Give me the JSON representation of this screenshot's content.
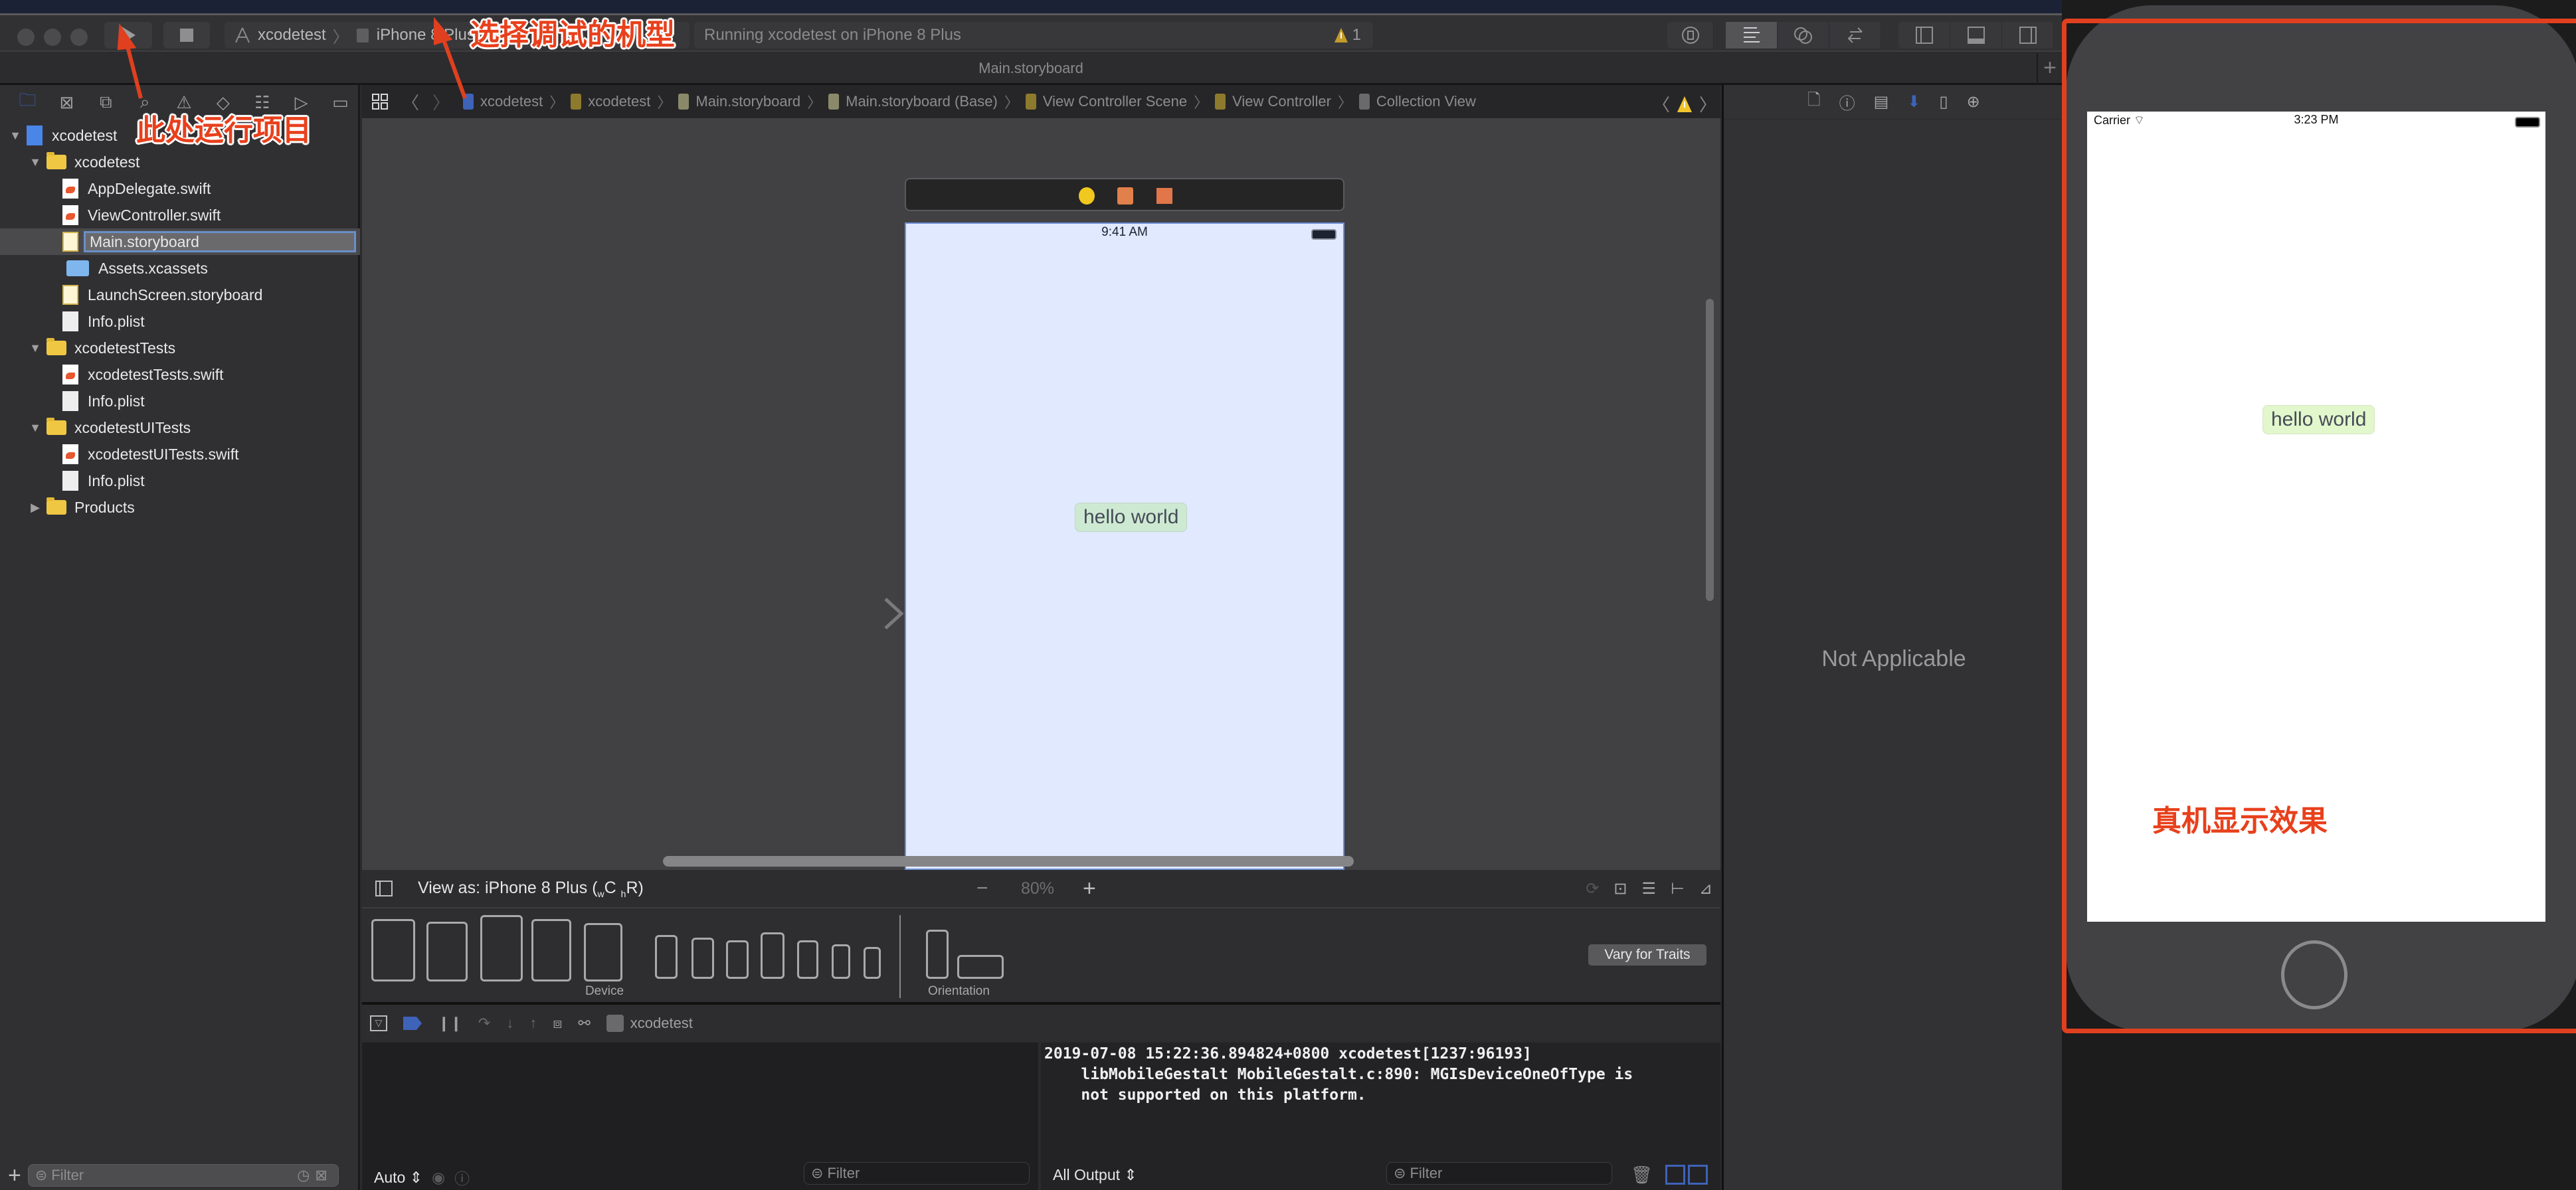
{
  "toolbar": {
    "scheme_target": "xcodetest",
    "scheme_device": "iPhone 8 Plus",
    "activity_text": "Running xcodetest on iPhone 8 Plus",
    "warning_count": "1",
    "run_icon": "play-icon",
    "stop_icon": "stop-icon"
  },
  "tab": {
    "title": "Main.storyboard"
  },
  "annotations": {
    "run_here": "此处运行项目",
    "choose_device": "选择调试的机型",
    "device_result": "真机显示效果"
  },
  "navigator": {
    "tabs": [
      "folder-icon",
      "source-control-icon",
      "symbol-icon",
      "find-icon",
      "issue-icon",
      "test-icon",
      "debug-icon",
      "breakpoint-icon",
      "report-icon"
    ],
    "tree": [
      {
        "label": "xcodetest",
        "kind": "project",
        "depth": 0,
        "expanded": true
      },
      {
        "label": "xcodetest",
        "kind": "folder",
        "depth": 1,
        "expanded": true
      },
      {
        "label": "AppDelegate.swift",
        "kind": "swift",
        "depth": 2
      },
      {
        "label": "ViewController.swift",
        "kind": "swift",
        "depth": 2
      },
      {
        "label": "Main.storyboard",
        "kind": "storyboard",
        "depth": 2,
        "selected": true
      },
      {
        "label": "Assets.xcassets",
        "kind": "assets",
        "depth": 2
      },
      {
        "label": "LaunchScreen.storyboard",
        "kind": "storyboard",
        "depth": 2
      },
      {
        "label": "Info.plist",
        "kind": "plist",
        "depth": 2
      },
      {
        "label": "xcodetestTests",
        "kind": "folder",
        "depth": 1,
        "expanded": true
      },
      {
        "label": "xcodetestTests.swift",
        "kind": "swift",
        "depth": 2
      },
      {
        "label": "Info.plist",
        "kind": "plist",
        "depth": 2
      },
      {
        "label": "xcodetestUITests",
        "kind": "folder",
        "depth": 1,
        "expanded": true
      },
      {
        "label": "xcodetestUITests.swift",
        "kind": "swift",
        "depth": 2
      },
      {
        "label": "Info.plist",
        "kind": "plist",
        "depth": 2
      },
      {
        "label": "Products",
        "kind": "folder",
        "depth": 1,
        "expanded": false
      }
    ],
    "filter_placeholder": "Filter"
  },
  "breadcrumb": [
    "xcodetest",
    "xcodetest",
    "Main.storyboard",
    "Main.storyboard (Base)",
    "View Controller Scene",
    "View Controller",
    "Collection View"
  ],
  "canvas": {
    "status_time": "9:41 AM",
    "label_text": "hello world"
  },
  "editor_bottom": {
    "view_as": "View as: iPhone 8 Plus (",
    "traits_w": "w",
    "traits_c": "C ",
    "traits_h": "h",
    "traits_r": "R)",
    "zoom_level": "80%",
    "zoom_out": "−",
    "zoom_in": "+",
    "device_caption": "Device",
    "orientation_caption": "Orientation",
    "vary_button": "Vary for Traits"
  },
  "debug": {
    "process": "xcodetest",
    "scope_select": "Auto",
    "output_select": "All Output",
    "filter_placeholder": "Filter",
    "console_lines": [
      "2019-07-08 15:22:36.894824+0800 xcodetest[1237:96193]",
      "    libMobileGestalt MobileGestalt.c:890: MGIsDeviceOneOfType is",
      "    not supported on this platform."
    ]
  },
  "inspector": {
    "empty_text": "Not Applicable",
    "tabs": [
      "file-icon",
      "help-icon",
      "identity-icon",
      "attributes-icon",
      "size-icon",
      "connections-icon"
    ]
  },
  "simulator": {
    "carrier": "Carrier",
    "time": "3:23 PM",
    "label_text": "hello world"
  },
  "colors": {
    "annotation_red": "#e0401f",
    "accent_blue": "#3e63b8",
    "warning_yellow": "#e8c22c"
  }
}
